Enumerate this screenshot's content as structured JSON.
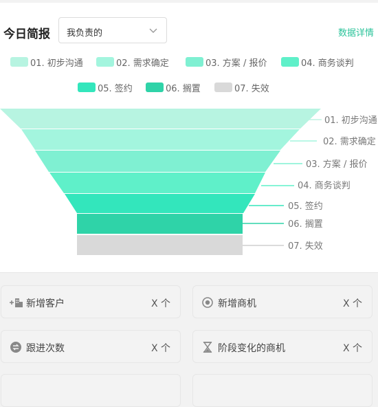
{
  "header": {
    "title": "今日简报",
    "filter_value": "我负责的",
    "details_link": "数据详情"
  },
  "legend": [
    {
      "label": "01. 初步沟通",
      "color": "#b7f4e1"
    },
    {
      "label": "02. 需求确定",
      "color": "#a3f5de"
    },
    {
      "label": "03. 方案 / 报价",
      "color": "#7ff0d2"
    },
    {
      "label": "04. 商务谈判",
      "color": "#5ff0c9"
    },
    {
      "label": "05. 签约",
      "color": "#33e6bc"
    },
    {
      "label": "06. 搁置",
      "color": "#2fd3a8"
    },
    {
      "label": "07. 失效",
      "color": "#d9d9d9"
    }
  ],
  "funnel_labels": [
    "01. 初步沟通",
    "02. 需求确定",
    "03. 方案 / 报价",
    "04. 商务谈判",
    "05. 签约",
    "06. 搁置",
    "07. 失效"
  ],
  "cards": [
    {
      "label": "新增客户",
      "count": "X 个",
      "icon": "add-customer-icon"
    },
    {
      "label": "新增商机",
      "count": "X 个",
      "icon": "target-icon"
    },
    {
      "label": "跟进次数",
      "count": "X 个",
      "icon": "follow-up-icon"
    },
    {
      "label": "阶段变化的商机",
      "count": "X 个",
      "icon": "hourglass-icon"
    }
  ]
}
